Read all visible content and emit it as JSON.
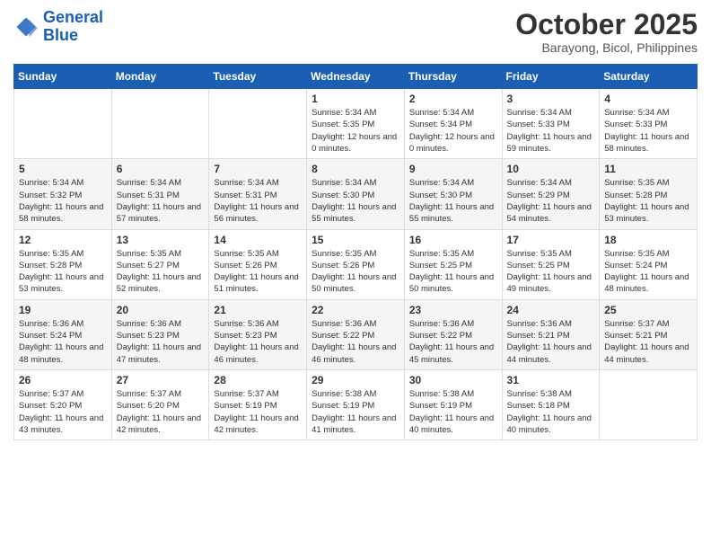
{
  "header": {
    "logo_line1": "General",
    "logo_line2": "Blue",
    "month": "October 2025",
    "location": "Barayong, Bicol, Philippines"
  },
  "weekdays": [
    "Sunday",
    "Monday",
    "Tuesday",
    "Wednesday",
    "Thursday",
    "Friday",
    "Saturday"
  ],
  "weeks": [
    [
      {
        "day": "",
        "sunrise": "",
        "sunset": "",
        "daylight": ""
      },
      {
        "day": "",
        "sunrise": "",
        "sunset": "",
        "daylight": ""
      },
      {
        "day": "",
        "sunrise": "",
        "sunset": "",
        "daylight": ""
      },
      {
        "day": "1",
        "sunrise": "Sunrise: 5:34 AM",
        "sunset": "Sunset: 5:35 PM",
        "daylight": "Daylight: 12 hours and 0 minutes."
      },
      {
        "day": "2",
        "sunrise": "Sunrise: 5:34 AM",
        "sunset": "Sunset: 5:34 PM",
        "daylight": "Daylight: 12 hours and 0 minutes."
      },
      {
        "day": "3",
        "sunrise": "Sunrise: 5:34 AM",
        "sunset": "Sunset: 5:33 PM",
        "daylight": "Daylight: 11 hours and 59 minutes."
      },
      {
        "day": "4",
        "sunrise": "Sunrise: 5:34 AM",
        "sunset": "Sunset: 5:33 PM",
        "daylight": "Daylight: 11 hours and 58 minutes."
      }
    ],
    [
      {
        "day": "5",
        "sunrise": "Sunrise: 5:34 AM",
        "sunset": "Sunset: 5:32 PM",
        "daylight": "Daylight: 11 hours and 58 minutes."
      },
      {
        "day": "6",
        "sunrise": "Sunrise: 5:34 AM",
        "sunset": "Sunset: 5:31 PM",
        "daylight": "Daylight: 11 hours and 57 minutes."
      },
      {
        "day": "7",
        "sunrise": "Sunrise: 5:34 AM",
        "sunset": "Sunset: 5:31 PM",
        "daylight": "Daylight: 11 hours and 56 minutes."
      },
      {
        "day": "8",
        "sunrise": "Sunrise: 5:34 AM",
        "sunset": "Sunset: 5:30 PM",
        "daylight": "Daylight: 11 hours and 55 minutes."
      },
      {
        "day": "9",
        "sunrise": "Sunrise: 5:34 AM",
        "sunset": "Sunset: 5:30 PM",
        "daylight": "Daylight: 11 hours and 55 minutes."
      },
      {
        "day": "10",
        "sunrise": "Sunrise: 5:34 AM",
        "sunset": "Sunset: 5:29 PM",
        "daylight": "Daylight: 11 hours and 54 minutes."
      },
      {
        "day": "11",
        "sunrise": "Sunrise: 5:35 AM",
        "sunset": "Sunset: 5:28 PM",
        "daylight": "Daylight: 11 hours and 53 minutes."
      }
    ],
    [
      {
        "day": "12",
        "sunrise": "Sunrise: 5:35 AM",
        "sunset": "Sunset: 5:28 PM",
        "daylight": "Daylight: 11 hours and 53 minutes."
      },
      {
        "day": "13",
        "sunrise": "Sunrise: 5:35 AM",
        "sunset": "Sunset: 5:27 PM",
        "daylight": "Daylight: 11 hours and 52 minutes."
      },
      {
        "day": "14",
        "sunrise": "Sunrise: 5:35 AM",
        "sunset": "Sunset: 5:26 PM",
        "daylight": "Daylight: 11 hours and 51 minutes."
      },
      {
        "day": "15",
        "sunrise": "Sunrise: 5:35 AM",
        "sunset": "Sunset: 5:26 PM",
        "daylight": "Daylight: 11 hours and 50 minutes."
      },
      {
        "day": "16",
        "sunrise": "Sunrise: 5:35 AM",
        "sunset": "Sunset: 5:25 PM",
        "daylight": "Daylight: 11 hours and 50 minutes."
      },
      {
        "day": "17",
        "sunrise": "Sunrise: 5:35 AM",
        "sunset": "Sunset: 5:25 PM",
        "daylight": "Daylight: 11 hours and 49 minutes."
      },
      {
        "day": "18",
        "sunrise": "Sunrise: 5:35 AM",
        "sunset": "Sunset: 5:24 PM",
        "daylight": "Daylight: 11 hours and 48 minutes."
      }
    ],
    [
      {
        "day": "19",
        "sunrise": "Sunrise: 5:36 AM",
        "sunset": "Sunset: 5:24 PM",
        "daylight": "Daylight: 11 hours and 48 minutes."
      },
      {
        "day": "20",
        "sunrise": "Sunrise: 5:36 AM",
        "sunset": "Sunset: 5:23 PM",
        "daylight": "Daylight: 11 hours and 47 minutes."
      },
      {
        "day": "21",
        "sunrise": "Sunrise: 5:36 AM",
        "sunset": "Sunset: 5:23 PM",
        "daylight": "Daylight: 11 hours and 46 minutes."
      },
      {
        "day": "22",
        "sunrise": "Sunrise: 5:36 AM",
        "sunset": "Sunset: 5:22 PM",
        "daylight": "Daylight: 11 hours and 46 minutes."
      },
      {
        "day": "23",
        "sunrise": "Sunrise: 5:36 AM",
        "sunset": "Sunset: 5:22 PM",
        "daylight": "Daylight: 11 hours and 45 minutes."
      },
      {
        "day": "24",
        "sunrise": "Sunrise: 5:36 AM",
        "sunset": "Sunset: 5:21 PM",
        "daylight": "Daylight: 11 hours and 44 minutes."
      },
      {
        "day": "25",
        "sunrise": "Sunrise: 5:37 AM",
        "sunset": "Sunset: 5:21 PM",
        "daylight": "Daylight: 11 hours and 44 minutes."
      }
    ],
    [
      {
        "day": "26",
        "sunrise": "Sunrise: 5:37 AM",
        "sunset": "Sunset: 5:20 PM",
        "daylight": "Daylight: 11 hours and 43 minutes."
      },
      {
        "day": "27",
        "sunrise": "Sunrise: 5:37 AM",
        "sunset": "Sunset: 5:20 PM",
        "daylight": "Daylight: 11 hours and 42 minutes."
      },
      {
        "day": "28",
        "sunrise": "Sunrise: 5:37 AM",
        "sunset": "Sunset: 5:19 PM",
        "daylight": "Daylight: 11 hours and 42 minutes."
      },
      {
        "day": "29",
        "sunrise": "Sunrise: 5:38 AM",
        "sunset": "Sunset: 5:19 PM",
        "daylight": "Daylight: 11 hours and 41 minutes."
      },
      {
        "day": "30",
        "sunrise": "Sunrise: 5:38 AM",
        "sunset": "Sunset: 5:19 PM",
        "daylight": "Daylight: 11 hours and 40 minutes."
      },
      {
        "day": "31",
        "sunrise": "Sunrise: 5:38 AM",
        "sunset": "Sunset: 5:18 PM",
        "daylight": "Daylight: 11 hours and 40 minutes."
      },
      {
        "day": "",
        "sunrise": "",
        "sunset": "",
        "daylight": ""
      }
    ]
  ]
}
